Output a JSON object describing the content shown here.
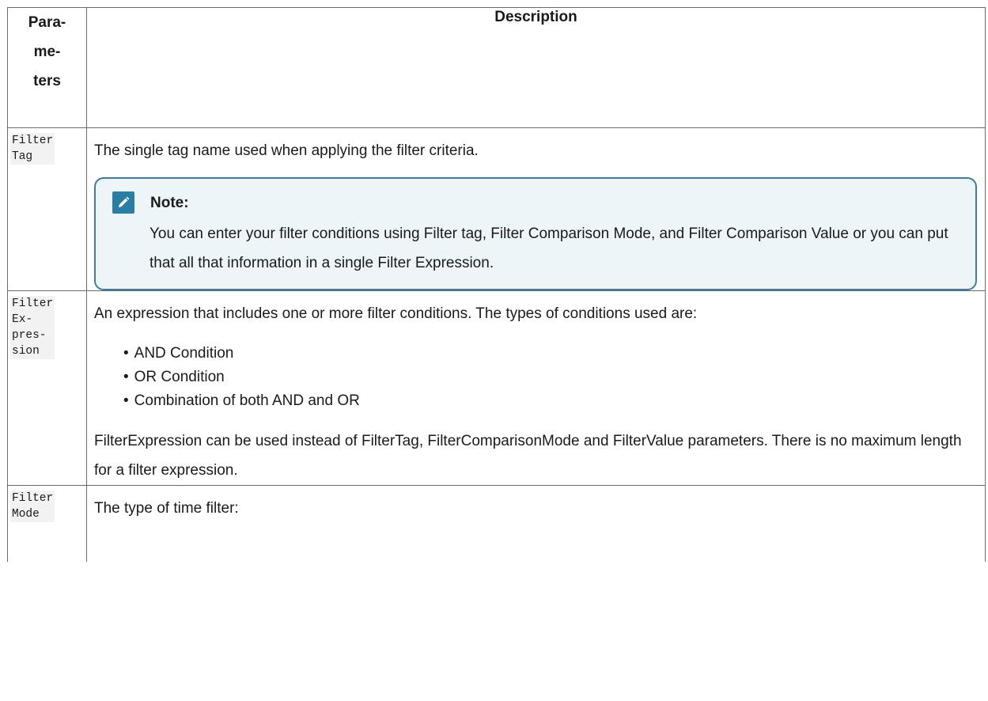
{
  "table": {
    "headers": {
      "param_lines": [
        "Para-",
        "me-",
        "ters"
      ],
      "description": "Description"
    },
    "rows": [
      {
        "param_lines": [
          "Filter",
          "Tag"
        ],
        "description": "The single tag name used when applying the filter criteria.",
        "note": {
          "icon": "pencil-icon",
          "title": "Note:",
          "text": "You can enter your filter conditions using Filter tag, Filter Comparison Mode, and Filter Comparison Value or you can put that all that information in a single Filter Expression."
        }
      },
      {
        "param_lines": [
          "Filter",
          "Ex-",
          "pres-",
          "sion"
        ],
        "description": "An expression that includes one or more filter conditions. The types of conditions used are:",
        "conditions": [
          "AND Condition",
          "OR Condition",
          "Combination of both AND and OR"
        ],
        "extra": "FilterExpression can be used instead of FilterTag, FilterComparisonMode and FilterValue parameters. There is no maximum length for a filter expression."
      },
      {
        "param_lines": [
          "Filter",
          "Mode"
        ],
        "description": "The type of time filter:"
      }
    ]
  },
  "colors": {
    "note_border": "#3a7ea0",
    "note_background": "#eef5f8",
    "icon_background": "#2a7ea3",
    "code_background": "#f2f2f2",
    "table_border": "#6b6b6b"
  }
}
